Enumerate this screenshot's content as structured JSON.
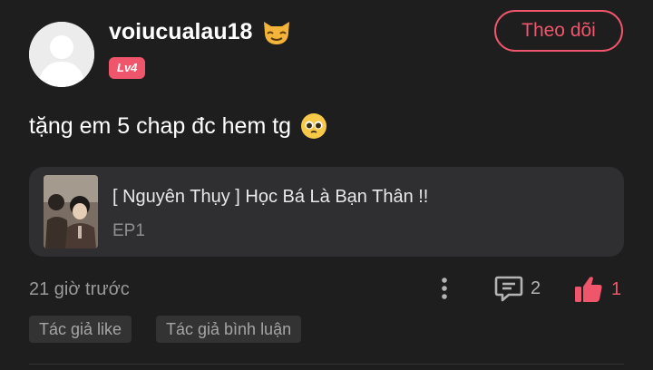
{
  "user": {
    "name": "voiucualau18",
    "level": "Lv4"
  },
  "follow": {
    "label": "Theo dõi"
  },
  "comment": {
    "text": "tặng em 5 chap đc hem tg"
  },
  "episode": {
    "title": "[ Nguyên Thụy ] Học Bá Là Bạn Thân !!",
    "subtitle": "EP1"
  },
  "meta": {
    "time": "21 giờ trước",
    "comment_count": "2",
    "like_count": "1"
  },
  "tags": [
    "Tác giả like",
    "Tác giả bình luận"
  ],
  "colors": {
    "accent": "#f0566b",
    "background": "#1e1e1e",
    "card": "#2f2f31"
  },
  "icons": [
    "avatar-placeholder-icon",
    "cat-emoji-icon",
    "pleading-face-emoji-icon",
    "more-vertical-icon",
    "comment-icon",
    "thumbs-up-icon"
  ]
}
